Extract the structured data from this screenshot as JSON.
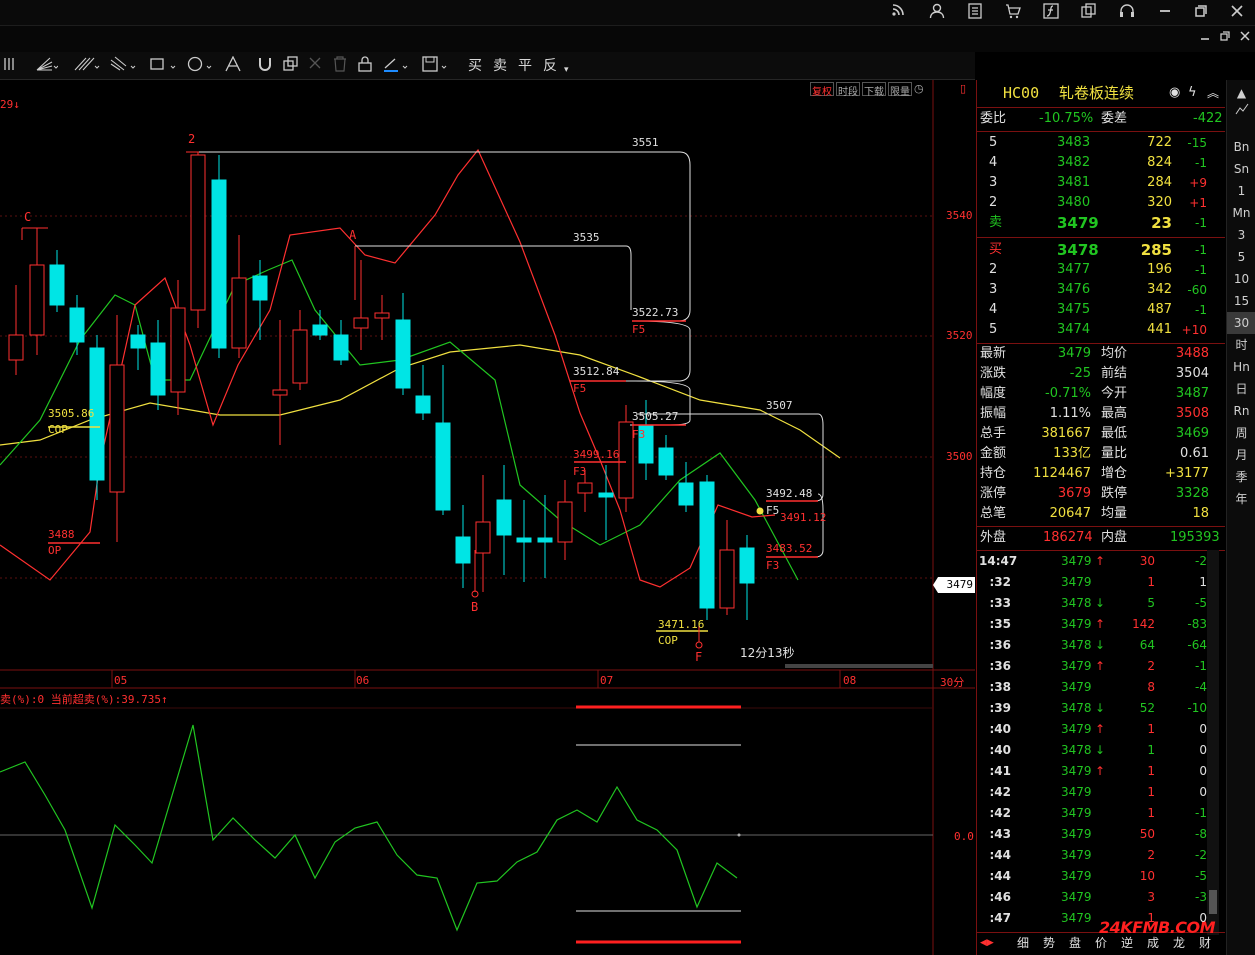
{
  "topbar": {
    "icons": [
      "rss-icon",
      "user-icon",
      "notes-icon",
      "cart-icon",
      "formula-icon",
      "copy-icon",
      "headset-icon",
      "minimize-icon",
      "restore-icon",
      "close-icon"
    ]
  },
  "toolbar": {
    "trade_buttons": [
      "买",
      "卖",
      "平",
      "反"
    ]
  },
  "chart": {
    "top_left_text": "29↓",
    "view_buttons": [
      "复权",
      "时段",
      "下载",
      "限量"
    ],
    "price_labels": [
      "3540",
      "3520",
      "3500"
    ],
    "current_price_tag": "3479",
    "time_labels": [
      "05",
      "06",
      "07",
      "08"
    ],
    "period_label": "30分",
    "countdown": "12分13秒",
    "annotations": {
      "peak_3551": "3551",
      "level_3535": "3535",
      "f5_3522": "3522.73",
      "f5_3512": "3512.84",
      "f3_3505": "3505.27",
      "f3_3499": "3499.16",
      "level_3507": "3507",
      "f5_3492": "3492.48",
      "val_3491": "3491.12",
      "f3_3483": "3483.52",
      "cop_3505": "3505.86",
      "cop_label": "COP",
      "op_3488": "3488",
      "op_label": "OP",
      "cop_3471": "3471.16",
      "cop_label2": "COP",
      "f5_label": "F5",
      "f3_label": "F3",
      "mark_c": "C",
      "mark_2": "2",
      "mark_A": "A",
      "mark_B": "B",
      "mark_F": "F"
    },
    "indicator_title": "卖(%):0  当前超卖(%):39.735↑",
    "indicator_zero": "0.0"
  },
  "quote": {
    "code": "HC00",
    "name": "轧卷板连续",
    "weibi_label": "委比",
    "weibi": "-10.75%",
    "weicha_label": "委差",
    "weicha": "-422",
    "asks": [
      {
        "level": "5",
        "price": "3483",
        "vol": "722",
        "chg": "-15"
      },
      {
        "level": "4",
        "price": "3482",
        "vol": "824",
        "chg": "-1"
      },
      {
        "level": "3",
        "price": "3481",
        "vol": "284",
        "chg": "+9"
      },
      {
        "level": "2",
        "price": "3480",
        "vol": "320",
        "chg": "+1"
      },
      {
        "level": "卖",
        "price": "3479",
        "vol": "23",
        "chg": "-1"
      }
    ],
    "bids": [
      {
        "level": "买",
        "price": "3478",
        "vol": "285",
        "chg": "-1"
      },
      {
        "level": "2",
        "price": "3477",
        "vol": "196",
        "chg": "-1"
      },
      {
        "level": "3",
        "price": "3476",
        "vol": "342",
        "chg": "-60"
      },
      {
        "level": "4",
        "price": "3475",
        "vol": "487",
        "chg": "-1"
      },
      {
        "level": "5",
        "price": "3474",
        "vol": "441",
        "chg": "+10"
      }
    ],
    "stats": [
      {
        "l1": "最新",
        "v1": "3479",
        "l2": "均价",
        "v2": "3488",
        "c1": "g",
        "c2": "r"
      },
      {
        "l1": "涨跌",
        "v1": "-25",
        "l2": "前结",
        "v2": "3504",
        "c1": "g",
        "c2": "w"
      },
      {
        "l1": "幅度",
        "v1": "-0.71%",
        "l2": "今开",
        "v2": "3487",
        "c1": "g",
        "c2": "g"
      },
      {
        "l1": "振幅",
        "v1": "1.11%",
        "l2": "最高",
        "v2": "3508",
        "c1": "w",
        "c2": "r"
      },
      {
        "l1": "总手",
        "v1": "381667",
        "l2": "最低",
        "v2": "3469",
        "c1": "y",
        "c2": "g"
      },
      {
        "l1": "金额",
        "v1": "133亿",
        "l2": "量比",
        "v2": "0.61",
        "c1": "y",
        "c2": "w"
      },
      {
        "l1": "持仓",
        "v1": "1124467",
        "l2": "增仓",
        "v2": "+3177",
        "c1": "y",
        "c2": "y"
      },
      {
        "l1": "涨停",
        "v1": "3679",
        "l2": "跌停",
        "v2": "3328",
        "c1": "r",
        "c2": "g"
      },
      {
        "l1": "总笔",
        "v1": "20647",
        "l2": "均量",
        "v2": "18",
        "c1": "y",
        "c2": "y"
      }
    ],
    "waipan_label": "外盘",
    "waipan": "186274",
    "neipan_label": "内盘",
    "neipan": "195393",
    "ticks": [
      {
        "t": "14:47",
        "p": "3479",
        "d": "up",
        "v": "30",
        "c": "-2"
      },
      {
        "t": ":32",
        "p": "3479",
        "d": "",
        "v": "1",
        "c": "1"
      },
      {
        "t": ":33",
        "p": "3478",
        "d": "down",
        "v": "5",
        "c": "-5"
      },
      {
        "t": ":35",
        "p": "3479",
        "d": "up",
        "v": "142",
        "c": "-83"
      },
      {
        "t": ":36",
        "p": "3478",
        "d": "down",
        "v": "64",
        "c": "-64"
      },
      {
        "t": ":36",
        "p": "3479",
        "d": "up",
        "v": "2",
        "c": "-1"
      },
      {
        "t": ":38",
        "p": "3479",
        "d": "",
        "v": "8",
        "c": "-4"
      },
      {
        "t": ":39",
        "p": "3478",
        "d": "down",
        "v": "52",
        "c": "-10"
      },
      {
        "t": ":40",
        "p": "3479",
        "d": "up",
        "v": "1",
        "c": "0"
      },
      {
        "t": ":40",
        "p": "3478",
        "d": "down",
        "v": "1",
        "c": "0"
      },
      {
        "t": ":41",
        "p": "3479",
        "d": "up",
        "v": "1",
        "c": "0"
      },
      {
        "t": ":42",
        "p": "3479",
        "d": "",
        "v": "1",
        "c": "0"
      },
      {
        "t": ":42",
        "p": "3479",
        "d": "",
        "v": "1",
        "c": "-1"
      },
      {
        "t": ":43",
        "p": "3479",
        "d": "",
        "v": "50",
        "c": "-8"
      },
      {
        "t": ":44",
        "p": "3479",
        "d": "",
        "v": "2",
        "c": "-2"
      },
      {
        "t": ":44",
        "p": "3479",
        "d": "",
        "v": "10",
        "c": "-5"
      },
      {
        "t": ":46",
        "p": "3479",
        "d": "",
        "v": "3",
        "c": "-3"
      },
      {
        "t": ":47",
        "p": "3479",
        "d": "",
        "v": "1",
        "c": "0"
      }
    ],
    "bottom_tabs": [
      "细",
      "势",
      "盘",
      "价",
      "逆",
      "成",
      "龙",
      "财"
    ],
    "watermark": "24KFMB.COM"
  },
  "sidebar": {
    "items": [
      "Bn",
      "Sn",
      "1",
      "Mn",
      "3",
      "5",
      "10",
      "15",
      "30",
      "时",
      "Hn",
      "日",
      "Rn",
      "周",
      "月",
      "季",
      "年"
    ],
    "active": "30"
  },
  "colors": {
    "up": "#ff3030",
    "down": "#21c521",
    "cyan": "#00e5e5",
    "yellow": "#f0e040"
  }
}
